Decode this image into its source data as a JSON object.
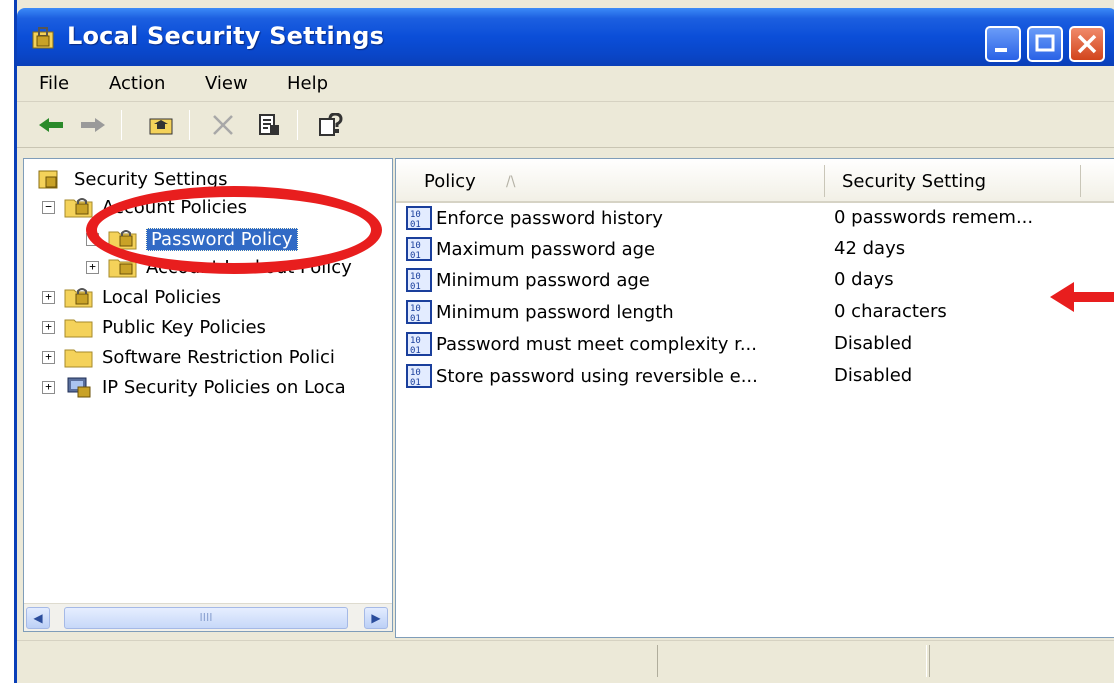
{
  "window": {
    "title": "Local Security Settings"
  },
  "menu": {
    "items": [
      {
        "label": "File"
      },
      {
        "label": "Action"
      },
      {
        "label": "View"
      },
      {
        "label": "Help"
      }
    ]
  },
  "toolbar": {
    "buttons": [
      "back-icon",
      "forward-icon",
      "up-folder-icon",
      "delete-icon",
      "properties-icon",
      "help-icon"
    ]
  },
  "tree": {
    "root": "Security Settings",
    "account_policies": "Account Policies",
    "password_policy": "Password Policy",
    "account_lockout_policy": "Account Lockout Policy",
    "local_policies": "Local Policies",
    "public_key_policies": "Public Key Policies",
    "software_restriction": "Software Restriction Polici",
    "ip_security": "IP Security Policies on Loca",
    "scroll_thumb_grip": "IIII"
  },
  "list": {
    "columns": {
      "policy": "Policy",
      "sort_indicator": "/\\",
      "setting": "Security Setting"
    },
    "rows": [
      {
        "policy": "Enforce password history",
        "setting": "0 passwords remem..."
      },
      {
        "policy": "Maximum password age",
        "setting": "42 days"
      },
      {
        "policy": "Minimum password age",
        "setting": "0 days"
      },
      {
        "policy": "Minimum password length",
        "setting": "0 characters"
      },
      {
        "policy": "Password must meet complexity r...",
        "setting": "Disabled"
      },
      {
        "policy": "Store password using reversible e...",
        "setting": "Disabled"
      }
    ]
  },
  "colors": {
    "titlebar": "#0a46c8",
    "selection": "#316ac5",
    "annotation": "#e81e1e",
    "chrome": "#ece9d8"
  }
}
